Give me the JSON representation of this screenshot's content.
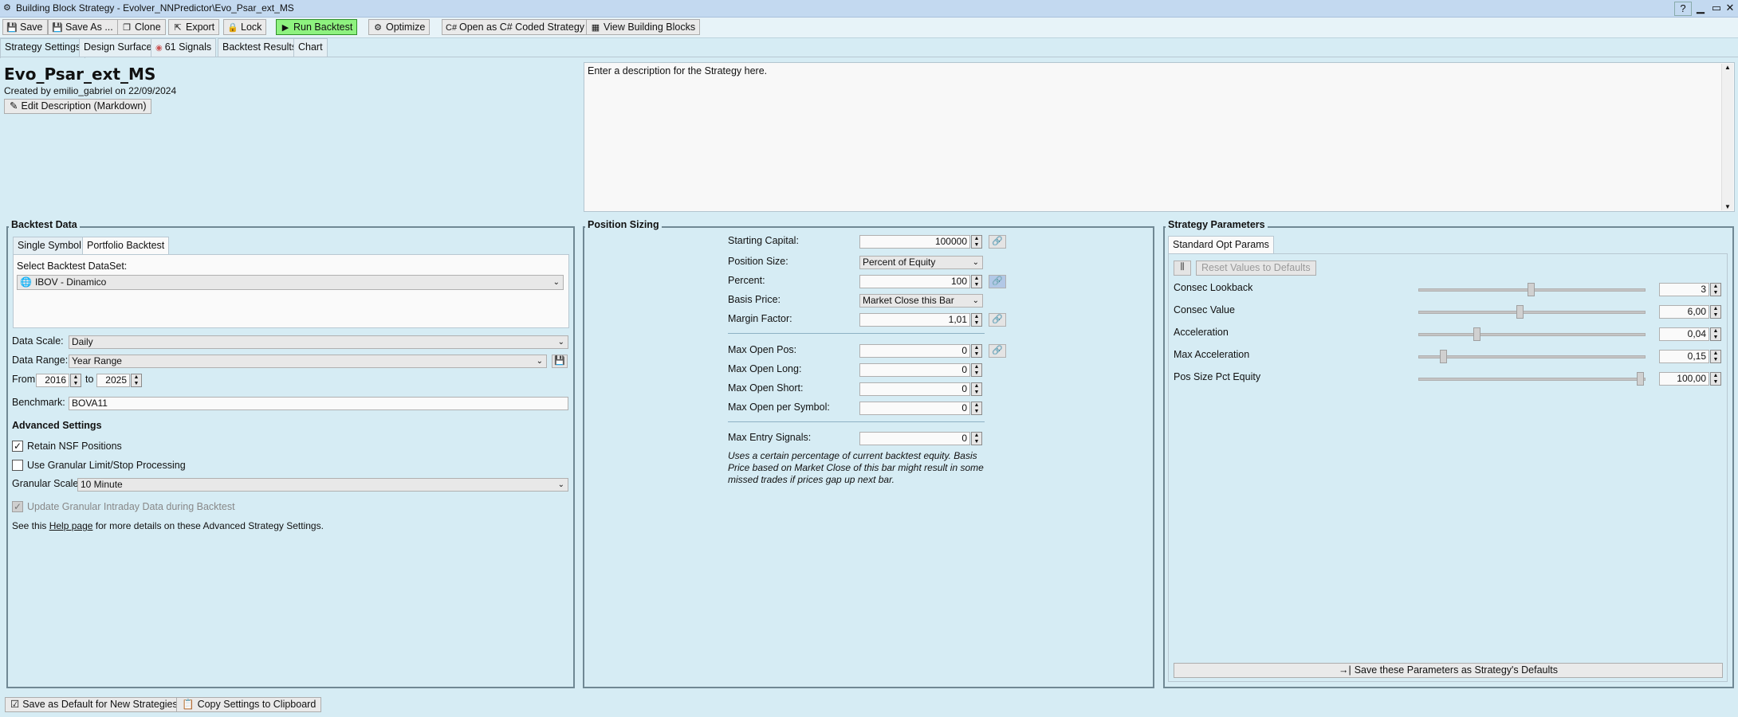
{
  "window": {
    "title": "Building Block Strategy - Evolver_NNPredictor\\Evo_Psar_ext_MS",
    "help": "?",
    "minimize": "▁",
    "maximize": "▭",
    "close": "✕"
  },
  "toolbar": {
    "save": "Save",
    "save_as": "Save As ...",
    "clone": "Clone",
    "export": "Export",
    "lock": "Lock",
    "run_backtest": "Run Backtest",
    "optimize": "Optimize",
    "open_csharp": "Open as C# Coded Strategy",
    "view_blocks": "View Building Blocks",
    "run_color": "#8ef27f"
  },
  "tabs": [
    "Strategy Settings",
    "Design Surface",
    "61 Signals",
    "Backtest Results",
    "Chart"
  ],
  "strategy": {
    "name": "Evo_Psar_ext_MS",
    "created": "Created by emilio_gabriel on 22/09/2024",
    "edit_description": "Edit Description (Markdown)",
    "description": "Enter a description for the Strategy here."
  },
  "backtest_data": {
    "title": "Backtest Data",
    "tabs": [
      "Single Symbol",
      "Portfolio Backtest"
    ],
    "select_label": "Select Backtest DataSet:",
    "dataset": "IBOV - Dinamico",
    "data_scale_label": "Data Scale:",
    "data_scale": "Daily",
    "data_range_label": "Data Range:",
    "data_range": "Year Range",
    "from_label": "From",
    "from": "2016",
    "to_label": "to",
    "to": "2025",
    "benchmark_label": "Benchmark:",
    "benchmark": "BOVA11",
    "advanced_title": "Advanced Settings",
    "retain_nsf": "Retain NSF Positions",
    "retain_nsf_checked": true,
    "granular_limit": "Use Granular Limit/Stop Processing",
    "granular_limit_checked": false,
    "granular_scale_label": "Granular Scale",
    "granular_scale": "10 Minute",
    "update_granular": "Update Granular Intraday Data during Backtest",
    "help_prefix": "See this",
    "help_link": "Help page",
    "help_suffix": "for more details on these Advanced Strategy Settings."
  },
  "position_sizing": {
    "title": "Position Sizing",
    "starting_capital_label": "Starting Capital:",
    "starting_capital": "100000",
    "position_size_label": "Position Size:",
    "position_size": "Percent of Equity",
    "percent_label": "Percent:",
    "percent": "100",
    "basis_price_label": "Basis Price:",
    "basis_price": "Market Close this Bar",
    "margin_factor_label": "Margin Factor:",
    "margin_factor": "1,01",
    "max_open_pos_label": "Max Open Pos:",
    "max_open_pos": "0",
    "max_open_long_label": "Max Open Long:",
    "max_open_long": "0",
    "max_open_short_label": "Max Open Short:",
    "max_open_short": "0",
    "max_open_symbol_label": "Max Open per Symbol:",
    "max_open_symbol": "0",
    "max_entry_label": "Max Entry Signals:",
    "max_entry": "0",
    "note_line1": "Uses a certain percentage of current backtest equity. Basis",
    "note_line2": "Price based on Market Close of this bar might result in some",
    "note_line3": "missed trades if prices gap up next bar."
  },
  "strategy_params": {
    "title": "Strategy Parameters",
    "tab": "Standard Opt Params",
    "reset": "Reset Values to Defaults",
    "save_defaults": "Save these Parameters as Strategy's Defaults",
    "params": [
      {
        "label": "Consec Lookback",
        "value": "3",
        "level": 0.5
      },
      {
        "label": "Consec Value",
        "value": "6,00",
        "level": 0.45
      },
      {
        "label": "Acceleration",
        "value": "0,04",
        "level": 0.25
      },
      {
        "label": "Max Acceleration",
        "value": "0,15",
        "level": 0.1
      },
      {
        "label": "Pos Size Pct Equity",
        "value": "100,00",
        "level": 1.0
      }
    ]
  },
  "footer": {
    "save_default": "Save as Default for New Strategies",
    "copy_settings": "Copy Settings to Clipboard"
  }
}
